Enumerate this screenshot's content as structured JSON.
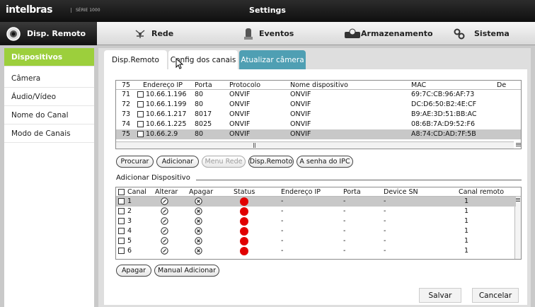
{
  "header": {
    "logo": "intelbras",
    "logo_sub": "SÉRIE 1000",
    "title": "Settings"
  },
  "nav": {
    "items": [
      {
        "label": "Disp. Remoto",
        "icon": "remote-device-icon",
        "active": true
      },
      {
        "label": "Rede",
        "icon": "network-icon",
        "active": false
      },
      {
        "label": "Eventos",
        "icon": "events-icon",
        "active": false
      },
      {
        "label": "Armazenamento",
        "icon": "storage-icon",
        "active": false
      },
      {
        "label": "Sistema",
        "icon": "system-gears-icon",
        "active": false
      }
    ]
  },
  "sidebar": {
    "items": [
      {
        "label": "Dispositivos",
        "active": true
      },
      {
        "label": "Câmera",
        "active": false
      },
      {
        "label": "Áudio/Vídeo",
        "active": false
      },
      {
        "label": "Nome do Canal",
        "active": false
      },
      {
        "label": "Modo de Canais",
        "active": false
      }
    ]
  },
  "tabs": [
    {
      "label": "Disp.Remoto",
      "active": false
    },
    {
      "label": "Config dos canais",
      "active": false
    },
    {
      "label": "Atualizar câmera",
      "active": true
    }
  ],
  "search_table": {
    "count": "75",
    "columns": [
      "Endereço IP",
      "Porta",
      "Protocolo",
      "Nome dispositivo",
      "MAC",
      "De"
    ],
    "rows": [
      {
        "num": "71",
        "ip": "10.66.1.196",
        "port": "80",
        "protocol": "ONVIF",
        "name": "ONVIF",
        "mac": "69:7C:CB:96:AF:73",
        "selected": false
      },
      {
        "num": "72",
        "ip": "10.66.1.199",
        "port": "80",
        "protocol": "ONVIF",
        "name": "ONVIF",
        "mac": "DC:D6:50:B2:4E:CF",
        "selected": false
      },
      {
        "num": "73",
        "ip": "10.66.1.217",
        "port": "8017",
        "protocol": "ONVIF",
        "name": "ONVIF",
        "mac": "B9:AE:3D:51:BB:AC",
        "selected": false
      },
      {
        "num": "74",
        "ip": "10.66.1.225",
        "port": "8025",
        "protocol": "ONVIF",
        "name": "ONVIF",
        "mac": "08:6B:7A:D9:52:F6",
        "selected": false
      },
      {
        "num": "75",
        "ip": "10.66.2.9",
        "port": "80",
        "protocol": "ONVIF",
        "name": "ONVIF",
        "mac": "A8:74:CD:AD:7F:5B",
        "selected": true
      }
    ]
  },
  "buttons": {
    "procurar": "Procurar",
    "adicionar": "Adicionar",
    "menu_rede": "Menu Rede",
    "disp_remoto": "Disp.Remoto",
    "senha_ipc": "A senha do IPC",
    "apagar": "Apagar",
    "manual_adicionar": "Manual Adicionar",
    "salvar": "Salvar",
    "cancelar": "Cancelar"
  },
  "added_section": {
    "title": "Adicionar Dispositivo"
  },
  "added_table": {
    "columns": [
      "Canal",
      "Alterar",
      "Apagar",
      "Status",
      "Endereço IP",
      "Porta",
      "Device SN",
      "Canal remoto"
    ],
    "rows": [
      {
        "channel": "1",
        "ip": "-",
        "port": "-",
        "sn": "-",
        "remote": "1",
        "status_color": "#e10000",
        "selected": true
      },
      {
        "channel": "2",
        "ip": "-",
        "port": "-",
        "sn": "-",
        "remote": "1",
        "status_color": "#e10000",
        "selected": false
      },
      {
        "channel": "3",
        "ip": "-",
        "port": "-",
        "sn": "-",
        "remote": "1",
        "status_color": "#e10000",
        "selected": false
      },
      {
        "channel": "4",
        "ip": "-",
        "port": "-",
        "sn": "-",
        "remote": "1",
        "status_color": "#e10000",
        "selected": false
      },
      {
        "channel": "5",
        "ip": "-",
        "port": "-",
        "sn": "-",
        "remote": "1",
        "status_color": "#e10000",
        "selected": false
      },
      {
        "channel": "6",
        "ip": "-",
        "port": "-",
        "sn": "-",
        "remote": "1",
        "status_color": "#e10000",
        "selected": false
      }
    ]
  },
  "colors": {
    "accent_green": "#9ccf3c",
    "tab_active": "#4f9fb3",
    "status_offline": "#e10000"
  }
}
